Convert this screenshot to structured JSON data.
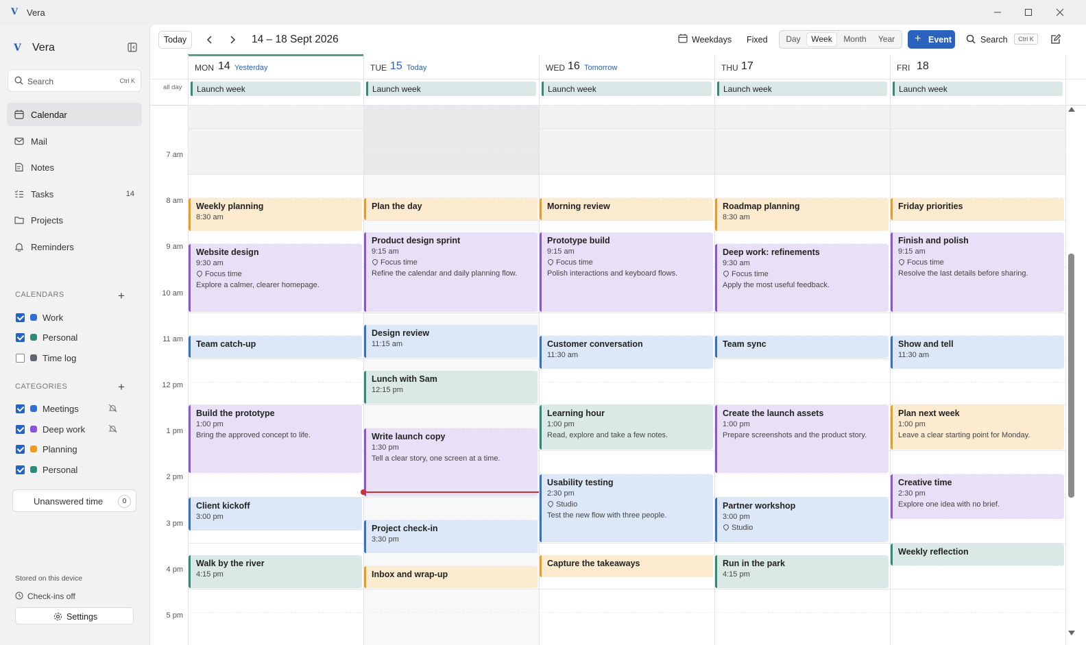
{
  "window": {
    "title": "Vera",
    "logo_letter": "V"
  },
  "sidebar": {
    "app_name": "Vera",
    "search": {
      "placeholder": "Search",
      "shortcut": "Ctrl K"
    },
    "nav": [
      {
        "label": "Calendar",
        "icon": "calendar-icon",
        "active": true
      },
      {
        "label": "Mail",
        "icon": "mail-icon"
      },
      {
        "label": "Notes",
        "icon": "notes-icon"
      },
      {
        "label": "Tasks",
        "icon": "tasks-icon",
        "count": "14"
      },
      {
        "label": "Projects",
        "icon": "folder-icon"
      },
      {
        "label": "Reminders",
        "icon": "bell-icon"
      }
    ],
    "calendars_header": "CALENDARS",
    "calendars": [
      {
        "label": "Work",
        "checked": true,
        "color": "#2f6fd6"
      },
      {
        "label": "Personal",
        "checked": true,
        "color": "#2e8a77"
      },
      {
        "label": "Time log",
        "checked": false,
        "color": "#5f6570"
      }
    ],
    "categories_header": "CATEGORIES",
    "categories": [
      {
        "label": "Meetings",
        "checked": true,
        "color": "#2f6fd6",
        "muted": true
      },
      {
        "label": "Deep work",
        "checked": true,
        "color": "#8a52de",
        "muted": true
      },
      {
        "label": "Planning",
        "checked": true,
        "color": "#ee9a1c"
      },
      {
        "label": "Personal",
        "checked": true,
        "color": "#2e8a77"
      }
    ],
    "unanswered": {
      "label": "Unanswered time",
      "count": "0"
    },
    "stored": "Stored on this device",
    "checkins": "Check-ins off",
    "settings": "Settings"
  },
  "toolbar": {
    "today": "Today",
    "range": "14 – 18 Sept 2026",
    "weekdays": "Weekdays",
    "fixed": "Fixed",
    "views": [
      "Day",
      "Week",
      "Month",
      "Year"
    ],
    "active_view": "Week",
    "new_event": "Event",
    "search": "Search",
    "search_shortcut": "Ctrl K"
  },
  "week": {
    "allday_label": "all day",
    "hours": [
      "7 am",
      "8 am",
      "9 am",
      "10 am",
      "11 am",
      "12 pm",
      "1 pm",
      "2 pm",
      "3 pm",
      "4 pm",
      "5 pm"
    ],
    "days": [
      {
        "name": "MON",
        "num": "14",
        "rel": "Yesterday",
        "allday": "Launch week"
      },
      {
        "name": "TUE",
        "num": "15",
        "rel": "Today",
        "allday": "Launch week",
        "today": true
      },
      {
        "name": "WED",
        "num": "16",
        "rel": "Tomorrow",
        "allday": "Launch week"
      },
      {
        "name": "THU",
        "num": "17",
        "rel": "",
        "allday": "Launch week"
      },
      {
        "name": "FRI",
        "num": "18",
        "rel": "",
        "allday": "Launch week"
      }
    ],
    "now_time": "2:50 pm",
    "events": [
      {
        "day": 0,
        "cat": "plan",
        "title": "Weekly planning",
        "time": "8:30 am",
        "start": 8.5,
        "end": 9.25
      },
      {
        "day": 0,
        "cat": "deep",
        "title": "Website design",
        "time": "9:30 am",
        "loc": "Focus time",
        "desc": "Explore a calmer, clearer homepage.",
        "start": 9.5,
        "end": 11.0
      },
      {
        "day": 0,
        "cat": "meet",
        "title": "Team catch-up",
        "start": 11.5,
        "end": 12.0
      },
      {
        "day": 0,
        "cat": "deep",
        "title": "Build the prototype",
        "time": "1:00 pm",
        "desc": "Bring the approved concept to life.",
        "start": 13.0,
        "end": 14.5
      },
      {
        "day": 0,
        "cat": "meet",
        "title": "Client kickoff",
        "time": "3:00 pm",
        "start": 15.0,
        "end": 15.75
      },
      {
        "day": 0,
        "cat": "pers",
        "title": "Walk by the river",
        "time": "4:15 pm",
        "start": 16.25,
        "end": 17.0
      },
      {
        "day": 1,
        "cat": "plan",
        "title": "Plan the day",
        "start": 8.5,
        "end": 9.0
      },
      {
        "day": 1,
        "cat": "deep",
        "title": "Product design sprint",
        "time": "9:15 am",
        "loc": "Focus time",
        "desc": "Refine the calendar and daily planning flow.",
        "start": 9.25,
        "end": 11.0
      },
      {
        "day": 1,
        "cat": "meet",
        "title": "Design review",
        "time": "11:15 am",
        "start": 11.25,
        "end": 12.0
      },
      {
        "day": 1,
        "cat": "pers",
        "title": "Lunch with Sam",
        "time": "12:15 pm",
        "start": 12.25,
        "end": 13.0
      },
      {
        "day": 1,
        "cat": "deep",
        "title": "Write launch copy",
        "time": "1:30 pm",
        "desc": "Tell a clear story, one screen at a time.",
        "start": 13.5,
        "end": 15.0
      },
      {
        "day": 1,
        "cat": "meet",
        "title": "Project check-in",
        "time": "3:30 pm",
        "start": 15.5,
        "end": 16.25
      },
      {
        "day": 1,
        "cat": "plan",
        "title": "Inbox and wrap-up",
        "start": 16.5,
        "end": 17.0
      },
      {
        "day": 2,
        "cat": "plan",
        "title": "Morning review",
        "start": 8.5,
        "end": 9.0
      },
      {
        "day": 2,
        "cat": "deep",
        "title": "Prototype build",
        "time": "9:15 am",
        "loc": "Focus time",
        "desc": "Polish interactions and keyboard flows.",
        "start": 9.25,
        "end": 11.0
      },
      {
        "day": 2,
        "cat": "meet",
        "title": "Customer conversation",
        "time": "11:30 am",
        "start": 11.5,
        "end": 12.25
      },
      {
        "day": 2,
        "cat": "pers",
        "title": "Learning hour",
        "time": "1:00 pm",
        "desc": "Read, explore and take a few notes.",
        "start": 13.0,
        "end": 14.0
      },
      {
        "day": 2,
        "cat": "meet",
        "title": "Usability testing",
        "time": "2:30 pm",
        "loc": "Studio",
        "desc": "Test the new flow with three people.",
        "start": 14.5,
        "end": 16.0
      },
      {
        "day": 2,
        "cat": "plan",
        "title": "Capture the takeaways",
        "start": 16.25,
        "end": 16.75
      },
      {
        "day": 3,
        "cat": "plan",
        "title": "Roadmap planning",
        "time": "8:30 am",
        "start": 8.5,
        "end": 9.25
      },
      {
        "day": 3,
        "cat": "deep",
        "title": "Deep work: refinements",
        "time": "9:30 am",
        "loc": "Focus time",
        "desc": "Apply the most useful feedback.",
        "start": 9.5,
        "end": 11.0
      },
      {
        "day": 3,
        "cat": "meet",
        "title": "Team sync",
        "start": 11.5,
        "end": 12.0
      },
      {
        "day": 3,
        "cat": "deep",
        "title": "Create the launch assets",
        "time": "1:00 pm",
        "desc": "Prepare screenshots and the product story.",
        "start": 13.0,
        "end": 14.5
      },
      {
        "day": 3,
        "cat": "meet",
        "title": "Partner workshop",
        "time": "3:00 pm",
        "loc": "Studio",
        "start": 15.0,
        "end": 16.0
      },
      {
        "day": 3,
        "cat": "pers",
        "title": "Run in the park",
        "time": "4:15 pm",
        "start": 16.25,
        "end": 17.0
      },
      {
        "day": 4,
        "cat": "plan",
        "title": "Friday priorities",
        "start": 8.5,
        "end": 9.0
      },
      {
        "day": 4,
        "cat": "deep",
        "title": "Finish and polish",
        "time": "9:15 am",
        "loc": "Focus time",
        "desc": "Resolve the last details before sharing.",
        "start": 9.25,
        "end": 11.0
      },
      {
        "day": 4,
        "cat": "meet",
        "title": "Show and tell",
        "time": "11:30 am",
        "start": 11.5,
        "end": 12.25
      },
      {
        "day": 4,
        "cat": "plan",
        "title": "Plan next week",
        "time": "1:00 pm",
        "desc": "Leave a clear starting point for Monday.",
        "start": 13.0,
        "end": 14.0
      },
      {
        "day": 4,
        "cat": "deep",
        "title": "Creative time",
        "time": "2:30 pm",
        "desc": "Explore one idea with no brief.",
        "start": 14.5,
        "end": 15.5
      },
      {
        "day": 4,
        "cat": "pers",
        "title": "Weekly reflection",
        "start": 16.0,
        "end": 16.5
      }
    ]
  }
}
